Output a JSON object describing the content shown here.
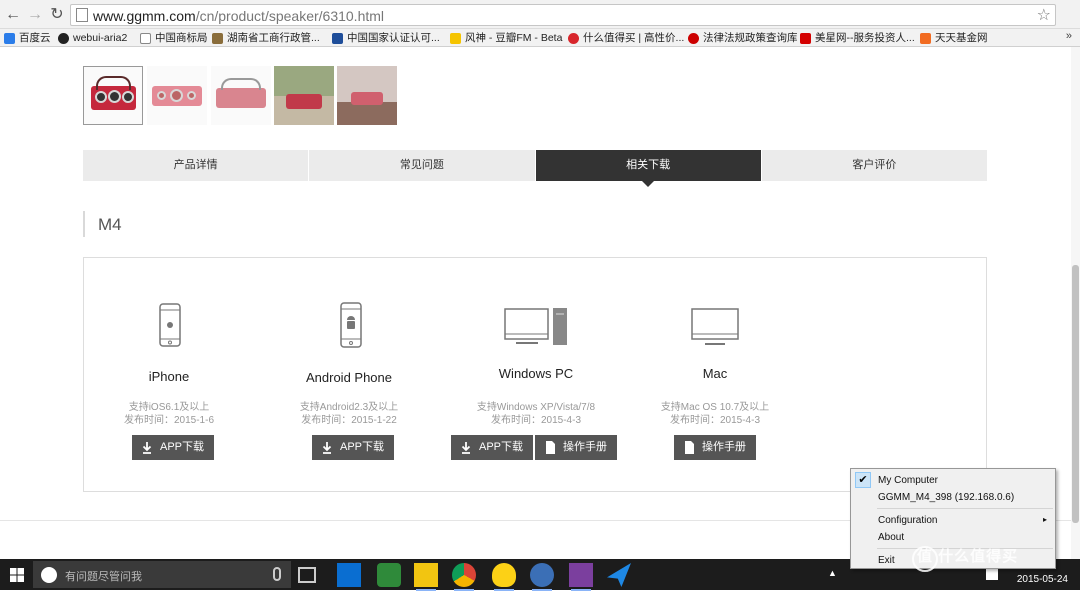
{
  "browser": {
    "url_host": "www.ggmm.com",
    "url_path": "/cn/product/speaker/6310.html",
    "bookmarks": [
      "百度云",
      "webui-aria2",
      "中国商标局",
      "湖南省工商行政管...",
      "中国国家认证认可...",
      "风神 - 豆瓣FM - Beta",
      "什么值得买 | 高性价...",
      "法律法规政策查询库",
      "美星网--服务投资人...",
      "天天基金网"
    ],
    "bookmarks_more": "»"
  },
  "tabs": [
    "产品详情",
    "常见问题",
    "相关下载",
    "客户评价"
  ],
  "active_tab": 2,
  "section_title": "M4",
  "downloads": [
    {
      "name": "iPhone",
      "support": "支持iOS6.1及以上",
      "date": "发布时间：2015-1-6",
      "buttons": [
        "APP下载"
      ]
    },
    {
      "name": "Android Phone",
      "support": "支持Android2.3及以上",
      "date": "发布时间：2015-1-22",
      "buttons": [
        "APP下载"
      ]
    },
    {
      "name": "Windows PC",
      "support": "支持Windows XP/Vista/7/8",
      "date": "发布时间：2015-4-3",
      "buttons": [
        "APP下载",
        "操作手册"
      ]
    },
    {
      "name": "Mac",
      "support": "支持Mac OS 10.7及以上",
      "date": "发布时间：2015-4-3",
      "buttons": [
        "操作手册"
      ]
    }
  ],
  "context_menu": {
    "items": [
      "My Computer",
      "GGMM_M4_398 (192.168.0.6)",
      "Configuration",
      "About",
      "Exit"
    ],
    "checked": "My Computer",
    "submenu_arrow": "▸"
  },
  "taskbar": {
    "search_placeholder": "有问题尽管问我",
    "date": "2015-05-24"
  },
  "watermark": "值 什么值得买",
  "colors": {
    "active_tab": "#333333",
    "button": "#555555",
    "taskbar": "#1c1c1c"
  }
}
